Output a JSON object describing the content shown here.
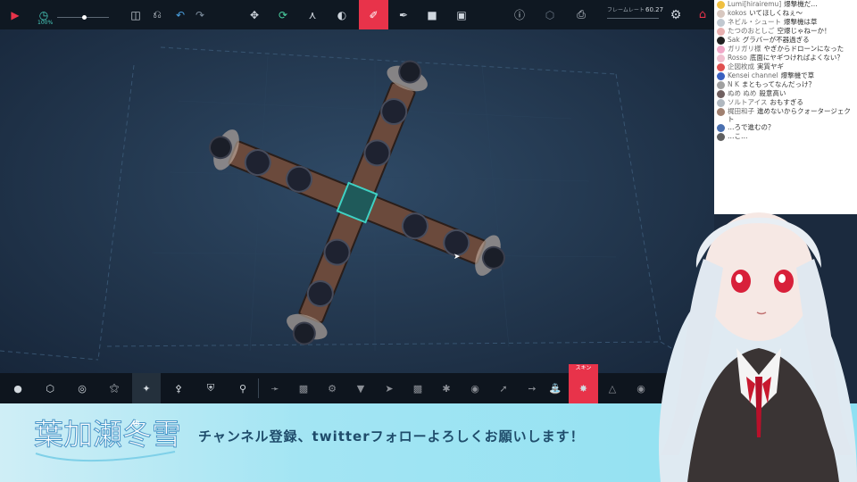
{
  "toolbar": {
    "speed_label": "100%",
    "framerate_label": "フレームレート",
    "framerate_value": "60.27"
  },
  "bottom_bar": {
    "skin_label": "スキン"
  },
  "chat": [
    {
      "author": "Lumi[hirairemu]",
      "text": "爆撃機だ…",
      "color": "#f0c040"
    },
    {
      "author": "kokos",
      "text": "いてほしくねぇ～",
      "color": "#d8c8c0"
    },
    {
      "author": "ネビル・シュート",
      "text": "爆撃機は草",
      "color": "#c0c8d0"
    },
    {
      "author": "たつのおとしご",
      "text": "空爆じゃねーか！",
      "color": "#e8b0b0"
    },
    {
      "author": "Sak",
      "text": "グラバーが不器過ぎる",
      "color": "#202020"
    },
    {
      "author": "ガリガリ様",
      "text": "やぎからドローンになった",
      "color": "#f0a8c8"
    },
    {
      "author": "Rosso",
      "text": "底面にヤギつければよくない？",
      "color": "#f0c0d0"
    },
    {
      "author": "企図枚成",
      "text": "実質ヤギ",
      "color": "#e05050"
    },
    {
      "author": "Kensei channel",
      "text": "爆撃機で草",
      "color": "#3a60c0"
    },
    {
      "author": "N K",
      "text": "まともってなんだっけ？",
      "color": "#a0a0a0"
    },
    {
      "author": "ぬめ ぬめ",
      "text": "殺意高い",
      "color": "#706060"
    },
    {
      "author": "ソルトアイス",
      "text": "おもすぎる",
      "color": "#b0b8c0"
    },
    {
      "author": "梶田和子",
      "text": "進めないからクォータージェクト",
      "color": "#a08070"
    },
    {
      "author": "",
      "text": "…ろで進むの？",
      "color": "#4a70b0"
    },
    {
      "author": "",
      "text": "…こ…",
      "color": "#606060"
    }
  ],
  "ticker": {
    "text": "チャンネル登録、twitterフォローよろしくお願いします！"
  },
  "logo": {
    "name": "葉加瀬冬雪"
  },
  "colors": {
    "accent": "#e8334a",
    "toolbar_bg": "#0f1822",
    "workspace": "#22364d",
    "banner": "#a3e5f3"
  }
}
